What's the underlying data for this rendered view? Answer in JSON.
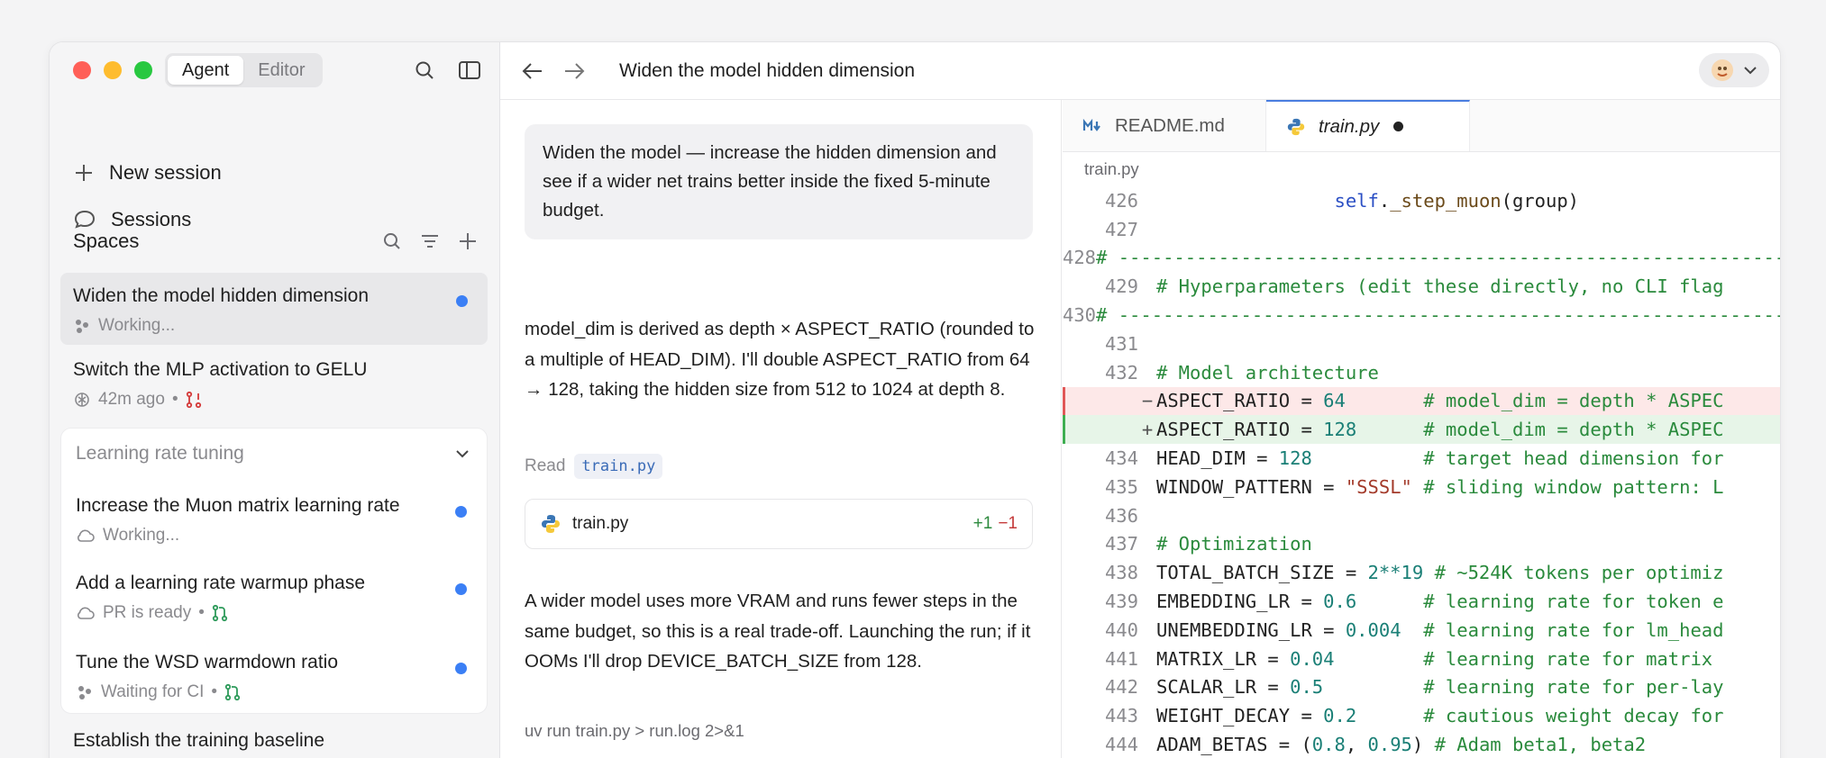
{
  "sidebar": {
    "mode_tabs": [
      "Agent",
      "Editor"
    ],
    "new_session": "New session",
    "sessions": "Sessions",
    "spaces": "Spaces",
    "items": [
      {
        "title": "Widen the model hidden dimension",
        "status": "Working..."
      },
      {
        "title": "Switch the MLP activation to GELU",
        "status": "42m ago"
      }
    ],
    "group": {
      "title": "Learning rate tuning",
      "items": [
        {
          "title": "Increase the Muon matrix learning rate",
          "status": "Working..."
        },
        {
          "title": "Add a learning rate warmup phase",
          "status": "PR is ready"
        },
        {
          "title": "Tune the WSD warmdown ratio",
          "status": "Waiting for CI"
        }
      ]
    },
    "bottom_item": "Establish the training baseline",
    "bullet": "•"
  },
  "topbar": {
    "title": "Widen the model hidden dimension"
  },
  "chat": {
    "prompt": "Widen the model — increase the hidden dimension and see if a wider net trains better inside the fixed 5-minute budget.",
    "response1": "model_dim is derived as depth × ASPECT_RATIO (rounded to a multiple of HEAD_DIM). I'll double ASPECT_RATIO from 64 → 128, taking the hidden size from 512 to 1024 at depth 8.",
    "read_label": "Read",
    "read_file": "train.py",
    "file_card_name": "train.py",
    "diff_plus": "+1",
    "diff_minus": "−1",
    "response2": "A wider model uses more VRAM and runs fewer steps in the same budget, so this is a real trade-off. Launching the run; if it OOMs I'll drop DEVICE_BATCH_SIZE from 128.",
    "command": "uv run train.py > run.log 2>&1"
  },
  "editor": {
    "tabs": [
      "README.md",
      "train.py"
    ],
    "breadcrumb": "train.py",
    "gutter_del": "−",
    "gutter_add": "+",
    "lines": [
      {
        "n": "426",
        "code": "                self._step_muon(group)"
      },
      {
        "n": "427",
        "code": ""
      },
      {
        "n": "428",
        "code": "# ---------------------------------------------------------------------------"
      },
      {
        "n": "429",
        "code": "# Hyperparameters (edit these directly, no CLI flag"
      },
      {
        "n": "430",
        "code": "# ---------------------------------------------------------------------------"
      },
      {
        "n": "431",
        "code": ""
      },
      {
        "n": "432",
        "code": "# Model architecture"
      },
      {
        "n": "",
        "code": "ASPECT_RATIO = 64       # model_dim = depth * ASPEC"
      },
      {
        "n": "",
        "code": "ASPECT_RATIO = 128      # model_dim = depth * ASPEC"
      },
      {
        "n": "434",
        "code": "HEAD_DIM = 128          # target head dimension for"
      },
      {
        "n": "435",
        "code": "WINDOW_PATTERN = \"SSSL\" # sliding window pattern: L"
      },
      {
        "n": "436",
        "code": ""
      },
      {
        "n": "437",
        "code": "# Optimization"
      },
      {
        "n": "438",
        "code": "TOTAL_BATCH_SIZE = 2**19 # ~524K tokens per optimiz"
      },
      {
        "n": "439",
        "code": "EMBEDDING_LR = 0.6      # learning rate for token e"
      },
      {
        "n": "440",
        "code": "UNEMBEDDING_LR = 0.004  # learning rate for lm_head"
      },
      {
        "n": "441",
        "code": "MATRIX_LR = 0.04        # learning rate for matrix"
      },
      {
        "n": "442",
        "code": "SCALAR_LR = 0.5         # learning rate for per-lay"
      },
      {
        "n": "443",
        "code": "WEIGHT_DECAY = 0.2      # cautious weight decay for"
      },
      {
        "n": "444",
        "code": "ADAM_BETAS = (0.8, 0.95) # Adam beta1, beta2"
      }
    ]
  },
  "colors": {
    "accent_blue": "#3b7ff5",
    "diff_add": "#2d8a3e",
    "diff_del": "#c43a3a"
  }
}
